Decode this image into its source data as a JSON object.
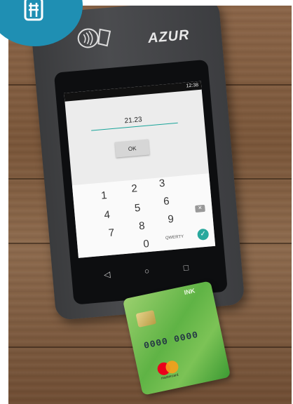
{
  "badge": {
    "icon": "pos-terminal-icon",
    "color": "#1f8fb3"
  },
  "terminal": {
    "brand": "AZUR",
    "status_time": "12:38",
    "amount": "21.23",
    "ok_label": "OK",
    "keypad": {
      "keys": [
        "1",
        "2",
        "3",
        "4",
        "5",
        "6",
        "7",
        "8",
        "9",
        "0"
      ],
      "qwerty_label": "QWERTY"
    }
  },
  "card": {
    "brand": "mastercard",
    "digits": "0000 0000",
    "bank_text": "INK",
    "colors": {
      "primary": "#5fb345",
      "accent": "#9bd06e"
    }
  }
}
